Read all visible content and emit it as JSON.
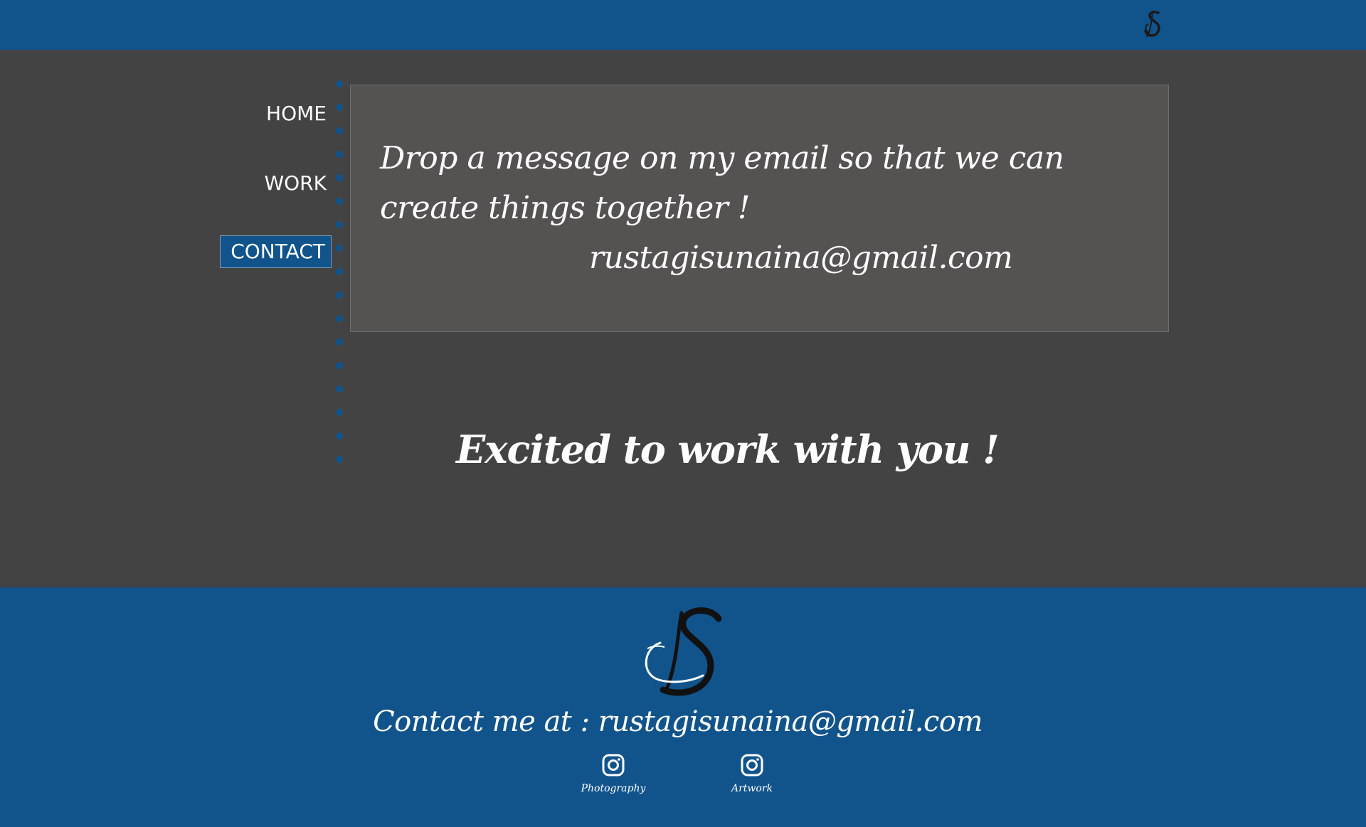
{
  "header": {
    "logo_icon": "js-monogram-icon"
  },
  "nav": {
    "items": [
      {
        "label": "HOME",
        "active": false
      },
      {
        "label": "WORK",
        "active": false
      },
      {
        "label": "CONTACT",
        "active": true
      }
    ],
    "active_color": "#11548c"
  },
  "message": {
    "text": "Drop a message on my email so that we can create things together !",
    "email": "rustagisunaina@gmail.com"
  },
  "tagline": "Excited to work with you !",
  "footer": {
    "logo_icon": "js-monogram-icon",
    "contact_text": "Contact me at : rustagisunaina@gmail.com",
    "socials": [
      {
        "icon": "instagram-icon",
        "label": "Photography"
      },
      {
        "icon": "instagram-icon",
        "label": "Artwork"
      }
    ]
  },
  "colors": {
    "brand_blue": "#11548c",
    "body_bg": "#434343",
    "panel_bg": "#545352"
  }
}
